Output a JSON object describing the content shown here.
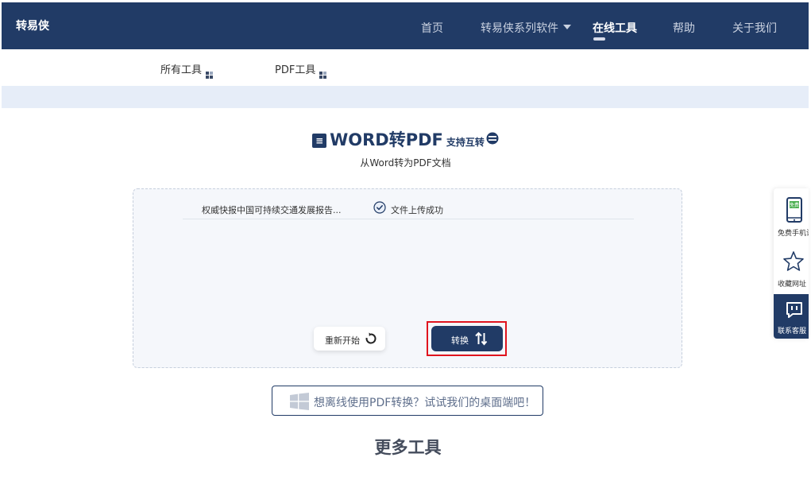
{
  "brand": "转易侠",
  "nav": {
    "items": [
      "首页",
      "转易侠系列软件",
      "在线工具",
      "帮助",
      "关于我们"
    ],
    "active_index": 2
  },
  "subnav": [
    "所有工具",
    "PDF工具"
  ],
  "tool": {
    "title": "WORD转PDF",
    "title_suffix": "支持互转",
    "subtitle": "从Word转为PDF文档"
  },
  "file": {
    "name": "权威快报中国可持续交通发展报告...",
    "status": "文件上传成功"
  },
  "buttons": {
    "restart": "重新开始",
    "convert": "转换"
  },
  "desktop_banner": "想离线使用PDF转换？试试我们的桌面端吧！",
  "more_tools": "更多工具",
  "side": {
    "mobile_badge": "免费",
    "mobile_label": "免费手机试",
    "bookmark_label": "收藏网址",
    "support_label": "联系客服"
  },
  "colors": {
    "primary": "#213b66",
    "highlight_border": "#e0141e",
    "panel_bg": "#f5f7fb",
    "band_bg": "#e6edf8",
    "badge_green": "#4caf50"
  },
  "icons": [
    "word-doc-icon",
    "swap-circle-icon",
    "check-circle-icon",
    "refresh-icon",
    "swap-arrows-icon",
    "windows-icon",
    "phone-icon",
    "star-icon",
    "chat-icon",
    "chevron-down-icon",
    "grid-icon"
  ]
}
